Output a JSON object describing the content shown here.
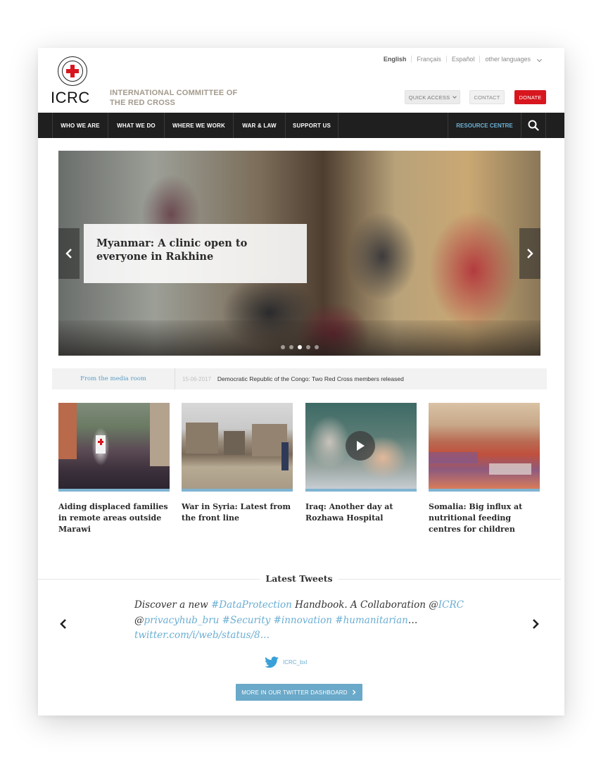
{
  "header": {
    "languages": [
      "English",
      "Français",
      "Español",
      "other languages"
    ],
    "logo_text": "ICRC",
    "org_name_line1": "INTERNATIONAL COMMITTEE OF",
    "org_name_line2": "THE RED CROSS",
    "quick_access": "QUICK ACCESS",
    "contact": "CONTACT",
    "donate": "DONATE"
  },
  "nav": {
    "items": [
      "WHO WE ARE",
      "WHAT WE DO",
      "WHERE WE WORK",
      "WAR & LAW",
      "SUPPORT US"
    ],
    "resource_centre": "RESOURCE CENTRE"
  },
  "hero": {
    "caption": "Myanmar: A clinic open to everyone in Rakhine",
    "slides_total": 5,
    "active_slide": 3
  },
  "media_room": {
    "label": "From the media room",
    "date": "15-06-2017",
    "headline": "Democratic Republic of the Congo: Two Red Cross members released"
  },
  "stories": [
    {
      "title": "Aiding displaced families in remote areas outside Marawi",
      "video": false
    },
    {
      "title": "War in Syria: Latest from the front line",
      "video": false
    },
    {
      "title": "Iraq: Another day at Rozhawa Hospital",
      "video": true
    },
    {
      "title": "Somalia: Big influx at nutritional feeding centres for children",
      "video": false
    }
  ],
  "tweets": {
    "title": "Latest Tweets",
    "t1": "Discover a new ",
    "t2": "#DataProtection",
    "t3": " Handbook. A Collaboration @",
    "t4": "ICRC",
    "t5": "@",
    "t6": "privacyhub_bru",
    "t7": " ",
    "t8": "#Security",
    "t9": " ",
    "t10": "#innovation",
    "t11": " ",
    "t12": "#humanitarian",
    "t13": "…",
    "t14": "twitter.com/i/web/status/8…",
    "handle": "ICRC_bxl",
    "button": "MORE IN OUR TWITTER DASHBOARD"
  },
  "colors": {
    "accent_red": "#d7161e",
    "nav_bg": "#1f1f1f",
    "link_blue": "#6aaed3"
  }
}
